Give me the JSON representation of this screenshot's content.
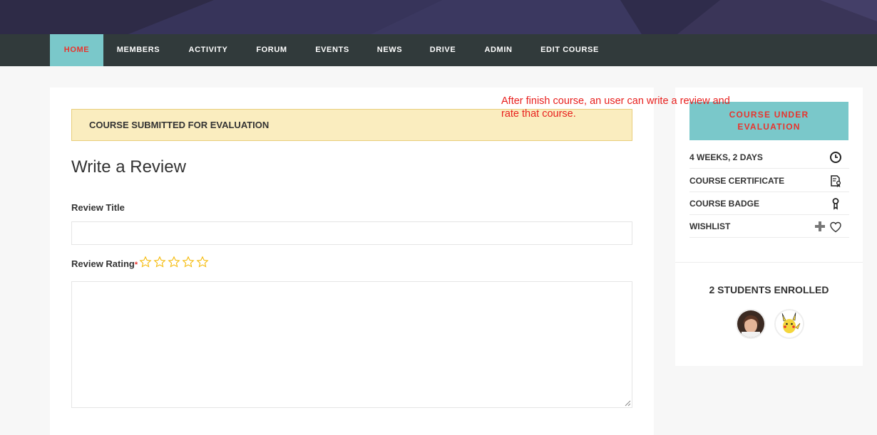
{
  "nav": {
    "items": [
      {
        "label": "HOME",
        "active": true
      },
      {
        "label": "MEMBERS"
      },
      {
        "label": "ACTIVITY"
      },
      {
        "label": "FORUM"
      },
      {
        "label": "EVENTS"
      },
      {
        "label": "NEWS"
      },
      {
        "label": "DRIVE"
      },
      {
        "label": "ADMIN"
      },
      {
        "label": "EDIT COURSE"
      }
    ]
  },
  "alert": {
    "text": "COURSE SUBMITTED FOR EVALUATION"
  },
  "review": {
    "title": "Write a Review",
    "title_label": "Review Title",
    "title_value": "",
    "rating_label": "Review Rating",
    "required_mark": "*",
    "rating": 0,
    "max_rating": 5,
    "body_value": ""
  },
  "annotation": {
    "text": "After finish course, an user can write a review and rate that course."
  },
  "sidebar": {
    "status_label": "COURSE UNDER EVALUATION",
    "details": [
      {
        "label": "4 WEEKS, 2 DAYS",
        "icon": "clock-icon"
      },
      {
        "label": "COURSE CERTIFICATE",
        "icon": "certificate-icon"
      },
      {
        "label": "COURSE BADGE",
        "icon": "badge-icon"
      },
      {
        "label": "WISHLIST",
        "icon": "heart-icon"
      }
    ],
    "enrolled_label": "2 STUDENTS ENROLLED",
    "students": [
      "student-avatar-1",
      "student-avatar-2"
    ]
  },
  "colors": {
    "accent": "#7ac8ca",
    "active_text": "#e8342d",
    "navbar": "#313a3b",
    "alert_bg": "#faedbf",
    "annotation": "#e8201e",
    "star": "#f5b800"
  }
}
